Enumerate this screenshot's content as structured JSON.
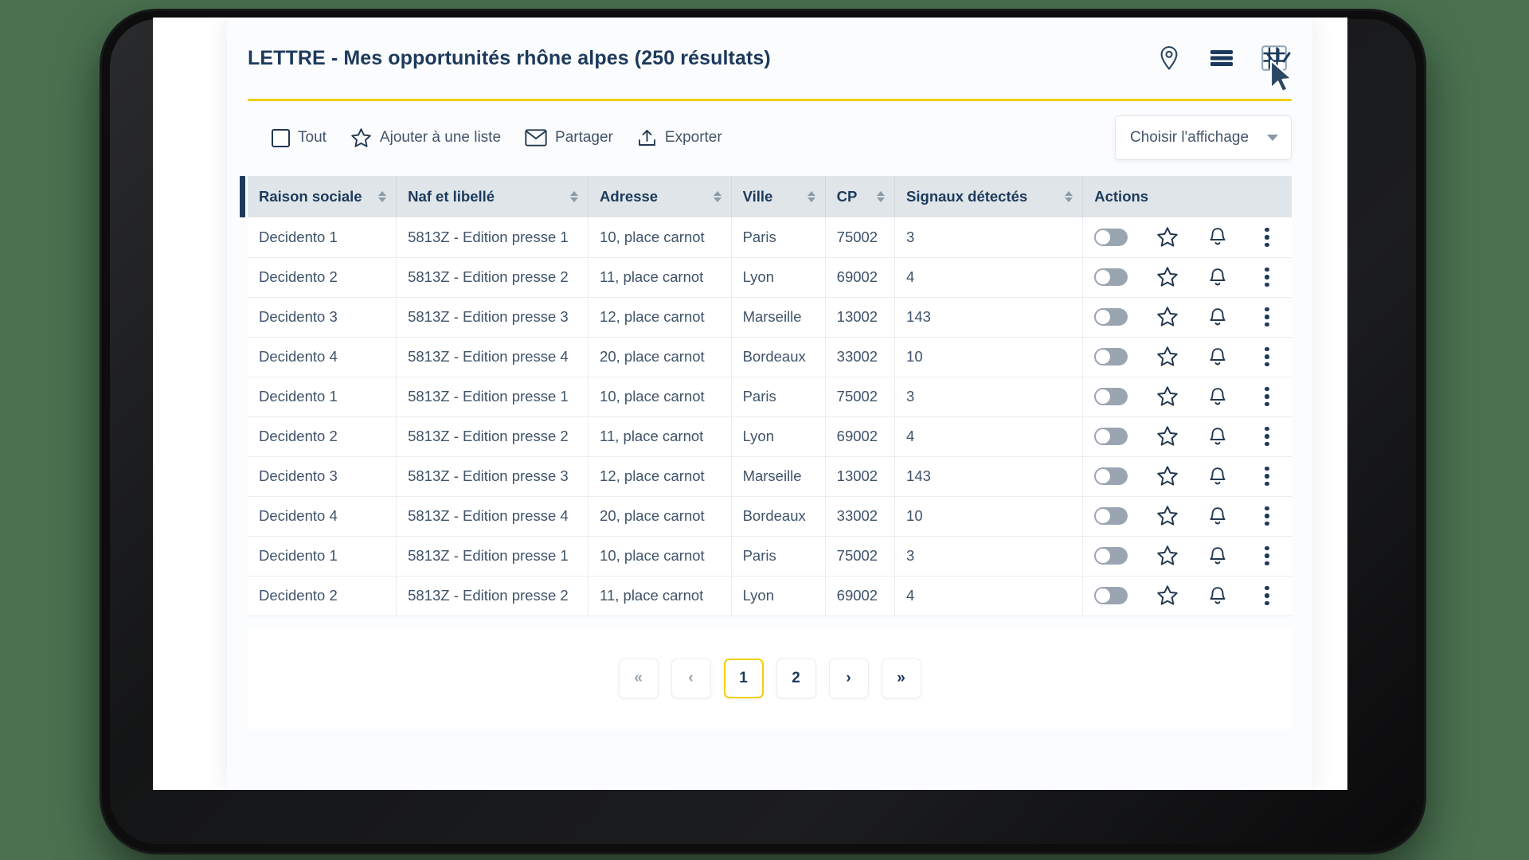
{
  "header": {
    "title": "LETTRE - Mes opportunités rhône alpes (250 résultats)",
    "icons": [
      {
        "name": "map-pin-icon",
        "label": "Carte"
      },
      {
        "name": "list-view-icon",
        "label": "Liste"
      },
      {
        "name": "grid-view-icon",
        "label": "Tableau"
      }
    ],
    "cursor": "mouse-cursor-click"
  },
  "accent_colors": {
    "rule_yellow": "#f2d010",
    "navy": "#1d3a5c",
    "header_gray": "#dfe5e8",
    "toggle_gray": "#9aa5b1",
    "page_background": "#4a7150"
  },
  "toolbar": {
    "select_all_label": "Tout",
    "add_to_list_label": "Ajouter à une liste",
    "share_label": "Partager",
    "export_label": "Exporter",
    "display_select": {
      "value": "Choisir l'affichage",
      "placeholder": "Choisir l'affichage"
    }
  },
  "table": {
    "columns": [
      {
        "label": "Raison sociale",
        "sortable": true
      },
      {
        "label": "Naf et libellé",
        "sortable": true
      },
      {
        "label": "Adresse",
        "sortable": true
      },
      {
        "label": "Ville",
        "sortable": true
      },
      {
        "label": "CP",
        "sortable": true
      },
      {
        "label": "Signaux détectés",
        "sortable": true
      },
      {
        "label": "Actions",
        "sortable": false
      }
    ],
    "rows": [
      {
        "raison": "Decidento 1",
        "naf": "5813Z - Edition presse 1",
        "adresse": "10, place carnot",
        "ville": "Paris",
        "cp": "75002",
        "signaux": "3"
      },
      {
        "raison": "Decidento 2",
        "naf": "5813Z - Edition presse 2",
        "adresse": "11, place carnot",
        "ville": "Lyon",
        "cp": "69002",
        "signaux": "4"
      },
      {
        "raison": "Decidento 3",
        "naf": "5813Z - Edition presse 3",
        "adresse": "12, place carnot",
        "ville": "Marseille",
        "cp": "13002",
        "signaux": "143"
      },
      {
        "raison": "Decidento 4",
        "naf": "5813Z - Edition presse 4",
        "adresse": "20, place carnot",
        "ville": "Bordeaux",
        "cp": "33002",
        "signaux": "10"
      },
      {
        "raison": "Decidento 1",
        "naf": "5813Z - Edition presse 1",
        "adresse": "10, place carnot",
        "ville": "Paris",
        "cp": "75002",
        "signaux": "3"
      },
      {
        "raison": "Decidento 2",
        "naf": "5813Z - Edition presse 2",
        "adresse": "11, place carnot",
        "ville": "Lyon",
        "cp": "69002",
        "signaux": "4"
      },
      {
        "raison": "Decidento 3",
        "naf": "5813Z - Edition presse 3",
        "adresse": "12, place carnot",
        "ville": "Marseille",
        "cp": "13002",
        "signaux": "143"
      },
      {
        "raison": "Decidento 4",
        "naf": "5813Z - Edition presse 4",
        "adresse": "20, place carnot",
        "ville": "Bordeaux",
        "cp": "33002",
        "signaux": "10"
      },
      {
        "raison": "Decidento 1",
        "naf": "5813Z - Edition presse 1",
        "adresse": "10, place carnot",
        "ville": "Paris",
        "cp": "75002",
        "signaux": "3"
      },
      {
        "raison": "Decidento 2",
        "naf": "5813Z - Edition presse 2",
        "adresse": "11, place carnot",
        "ville": "Lyon",
        "cp": "69002",
        "signaux": "4"
      }
    ],
    "row_action_icons": [
      "toggle-switch",
      "star-icon",
      "bell-icon",
      "kebab-menu-icon"
    ]
  },
  "pagination": {
    "buttons": [
      {
        "label": "«",
        "name": "pagination-first",
        "state": "muted"
      },
      {
        "label": "‹",
        "name": "pagination-previous",
        "state": "muted"
      },
      {
        "label": "1",
        "name": "pagination-page-1",
        "state": "active"
      },
      {
        "label": "2",
        "name": "pagination-page-2",
        "state": "normal"
      },
      {
        "label": "›",
        "name": "pagination-next",
        "state": "normal"
      },
      {
        "label": "»",
        "name": "pagination-last",
        "state": "normal"
      }
    ],
    "current_page": "1"
  }
}
